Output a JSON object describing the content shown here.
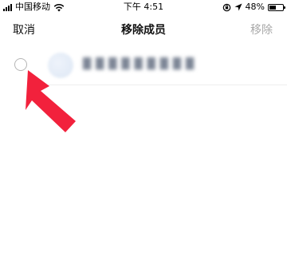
{
  "status_bar": {
    "carrier": "中国移动",
    "time": "下午 4:51",
    "battery_percent": "48%",
    "battery_level": 0.48
  },
  "nav": {
    "cancel_label": "取消",
    "title": "移除成员",
    "remove_label": "移除",
    "remove_color": "#a8a8a8"
  },
  "members": [
    {
      "checked": false
    }
  ],
  "colors": {
    "annotation_arrow": "#f2213c"
  }
}
